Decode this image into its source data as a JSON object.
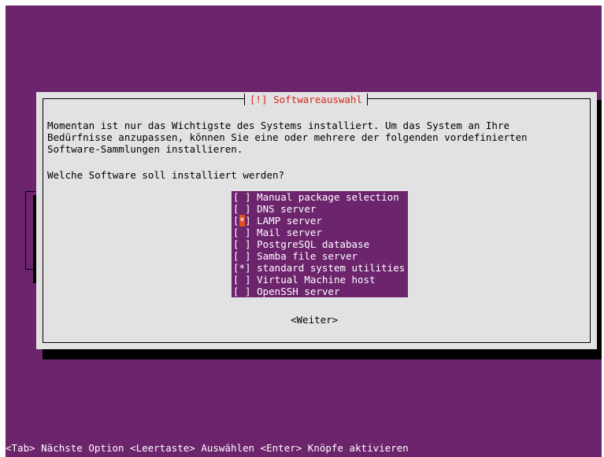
{
  "dialog": {
    "title": "[!] Softwareauswahl",
    "description": "Momentan ist nur das Wichtigste des Systems installiert. Um das System an Ihre\nBedürfnisse anzupassen, können Sie eine oder mehrere der folgenden vordefinierten\nSoftware-Sammlungen installieren.",
    "question": "Welche Software soll installiert werden?",
    "button_next": "<Weiter>"
  },
  "software_list": [
    {
      "checkbox": "[ ]",
      "label": "Manual package selection",
      "checked": false
    },
    {
      "checkbox": "[ ]",
      "label": "DNS server",
      "checked": false
    },
    {
      "checkbox": "[*]",
      "label": "LAMP server",
      "checked": true
    },
    {
      "checkbox": "[ ]",
      "label": "Mail server",
      "checked": false
    },
    {
      "checkbox": "[ ]",
      "label": "PostgreSQL database",
      "checked": false
    },
    {
      "checkbox": "[ ]",
      "label": "Samba file server",
      "checked": false
    },
    {
      "checkbox": "[*]",
      "label": "standard system utilities",
      "checked": true
    },
    {
      "checkbox": "[ ]",
      "label": "Virtual Machine host",
      "checked": false
    },
    {
      "checkbox": "[ ]",
      "label": "OpenSSH server",
      "checked": false
    }
  ],
  "status_bar": "<Tab> Nächste Option <Leertaste> Auswählen <Enter> Knöpfe aktivieren",
  "colors": {
    "background": "#6c246c",
    "dialog": "#e2e2e2",
    "title": "#d8281c",
    "cursor": "#e05020"
  }
}
